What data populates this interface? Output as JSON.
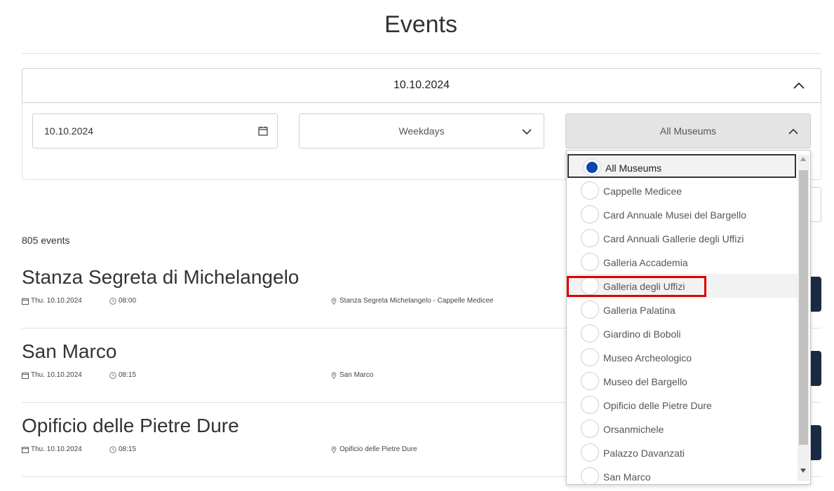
{
  "header": {
    "title": "Events"
  },
  "accordion": {
    "label": "10.10.2024"
  },
  "filters": {
    "date_value": "10.10.2024",
    "weekdays_label": "Weekdays",
    "museum_label": "All Museums"
  },
  "events_count": "805 events",
  "events": [
    {
      "title": "Stanza Segreta di Michelangelo",
      "date": "Thu. 10.10.2024",
      "time": "08:00",
      "location": "Stanza Segreta Michelangelo - Cappelle Medicee"
    },
    {
      "title": "San Marco",
      "date": "Thu. 10.10.2024",
      "time": "08:15",
      "location": "San Marco"
    },
    {
      "title": "Opificio delle Pietre Dure",
      "date": "Thu. 10.10.2024",
      "time": "08:15",
      "location": "Opificio delle Pietre Dure"
    }
  ],
  "museum_options": [
    "All Museums",
    "Cappelle Medicee",
    "Card Annuale Musei del Bargello",
    "Card Annuali Gallerie degli Uffizi",
    "Galleria Accademia",
    "Galleria degli Uffizi",
    "Galleria Palatina",
    "Giardino di Boboli",
    "Museo Archeologico",
    "Museo del Bargello",
    "Opificio delle Pietre Dure",
    "Orsanmichele",
    "Palazzo Davanzati",
    "San Marco"
  ],
  "colors": {
    "selected_radio": "#0b46b0",
    "highlight": "#e00000",
    "book_button": "#1b2a44"
  }
}
